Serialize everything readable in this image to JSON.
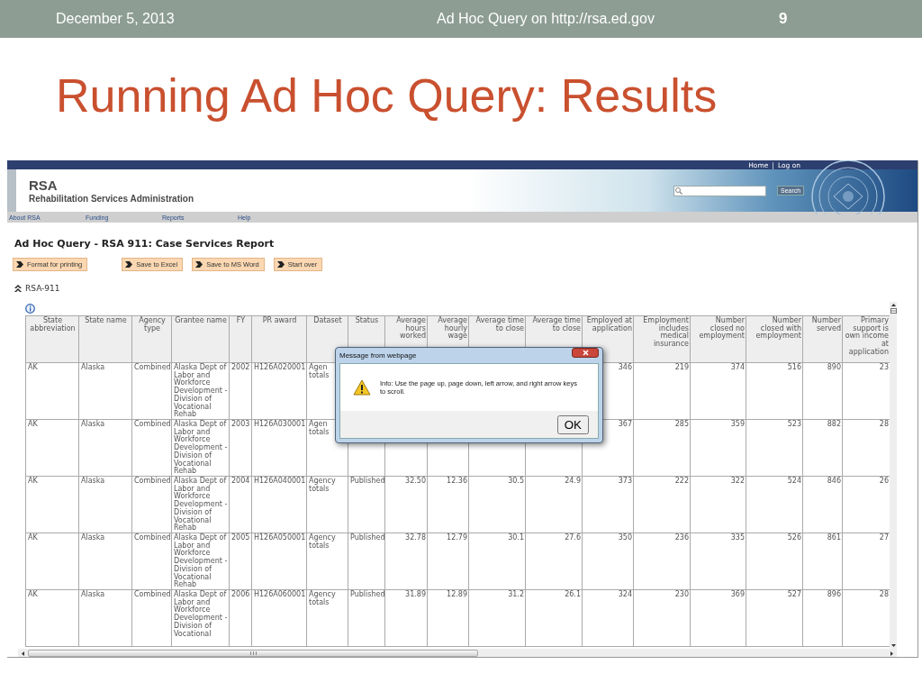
{
  "slide_header": {
    "date": "December 5, 2013",
    "title": "Ad Hoc Query on http://rsa.ed.gov",
    "page": "9"
  },
  "slide_title": "Running Ad Hoc Query: Results",
  "site": {
    "logo": "RSA",
    "subtitle": "Rehabilitation Services Administration",
    "top_links": [
      "Home",
      "Log on"
    ],
    "separator": "|",
    "search_button": "Search",
    "nav": [
      "About RSA",
      "Funding",
      "Reports",
      "Help"
    ]
  },
  "report": {
    "heading": "Ad Hoc Query - RSA 911: Case Services Report",
    "actions": [
      "Format for printing",
      "Save to Excel",
      "Save to MS Word",
      "Start over"
    ],
    "section": "RSA-911"
  },
  "table": {
    "columns": [
      {
        "label": "State abbreviation",
        "kind": "text"
      },
      {
        "label": "State name",
        "kind": "text"
      },
      {
        "label": "Agency type",
        "kind": "text"
      },
      {
        "label": "Grantee name",
        "kind": "text"
      },
      {
        "label": "FY",
        "kind": "text"
      },
      {
        "label": "PR award",
        "kind": "text"
      },
      {
        "label": "Dataset",
        "kind": "text"
      },
      {
        "label": "Status",
        "kind": "text"
      },
      {
        "label": "Average hours worked",
        "kind": "number"
      },
      {
        "label": "Average hourly wage",
        "kind": "number"
      },
      {
        "label": "Average time to close",
        "kind": "number"
      },
      {
        "label": "Average time to close",
        "kind": "number"
      },
      {
        "label": "Employed at application",
        "kind": "number"
      },
      {
        "label": "Employment includes medical insurance",
        "kind": "number"
      },
      {
        "label": "Number closed no employment",
        "kind": "number"
      },
      {
        "label": "Number closed with employment",
        "kind": "number"
      },
      {
        "label": "Number served",
        "kind": "number"
      },
      {
        "label": "Primary support is own income at application",
        "kind": "number"
      }
    ],
    "rows": [
      {
        "cells": [
          "AK",
          "Alaska",
          "Combined",
          "Alaska Dept of Labor and Workforce Development - Division of Vocational Rehab",
          "2002",
          "H126A020001",
          "Agen totals",
          null,
          null,
          null,
          null,
          null,
          "346",
          "219",
          "374",
          "516",
          "890",
          "23"
        ]
      },
      {
        "cells": [
          "AK",
          "Alaska",
          "Combined",
          "Alaska Dept of Labor and Workforce Development - Division of Vocational Rehab",
          "2003",
          "H126A030001",
          "Agen totals",
          null,
          null,
          null,
          null,
          null,
          "367",
          "285",
          "359",
          "523",
          "882",
          "28"
        ]
      },
      {
        "cells": [
          "AK",
          "Alaska",
          "Combined",
          "Alaska Dept of Labor and Workforce Development - Division of Vocational Rehab",
          "2004",
          "H126A040001",
          "Agency totals",
          "Published",
          "32.50",
          "12.36",
          "30.5",
          "24.9",
          "373",
          "222",
          "322",
          "524",
          "846",
          "26"
        ]
      },
      {
        "cells": [
          "AK",
          "Alaska",
          "Combined",
          "Alaska Dept of Labor and Workforce Development - Division of Vocational Rehab",
          "2005",
          "H126A050001",
          "Agency totals",
          "Published",
          "32.78",
          "12.79",
          "30.1",
          "27.6",
          "350",
          "236",
          "335",
          "526",
          "861",
          "27"
        ]
      },
      {
        "cells": [
          "AK",
          "Alaska",
          "Combined",
          "Alaska Dept of Labor and Workforce Development - Division of Vocational",
          "2006",
          "H126A060001",
          "Agency totals",
          "Published",
          "31.89",
          "12.89",
          "31.2",
          "26.1",
          "324",
          "230",
          "369",
          "527",
          "896",
          "28"
        ]
      }
    ]
  },
  "dialog": {
    "title": "Message from webpage",
    "message": "Info: Use the page up, page down, left arrow, and right arrow keys to scroll.",
    "button": "OK"
  }
}
